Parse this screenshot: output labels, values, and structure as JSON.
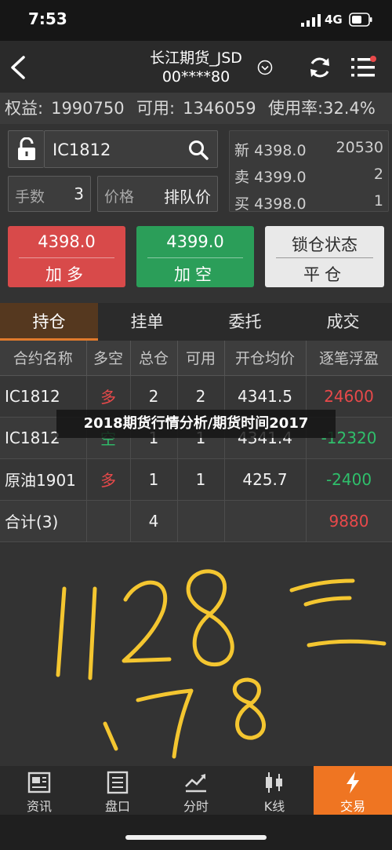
{
  "status": {
    "time": "7:53",
    "network": "4G"
  },
  "nav": {
    "title_line1": "长江期货_JSD",
    "title_line2": "00****80"
  },
  "account": {
    "equity_label": "权益:",
    "equity_value": "1990750",
    "available_label": "可用:",
    "available_value": "1346059",
    "usage_label": "使用率:",
    "usage_value": "32.4%"
  },
  "order": {
    "contract": "IC1812",
    "qty_label": "手数",
    "qty_value": "3",
    "price_label": "价格",
    "price_value": "排队价",
    "quotes": [
      {
        "label": "新",
        "price": "4398.0",
        "volume": "20530"
      },
      {
        "label": "卖",
        "price": "4399.0",
        "volume": "2"
      },
      {
        "label": "买",
        "price": "4398.0",
        "volume": "1"
      }
    ],
    "buttons": {
      "long_price": "4398.0",
      "long_label": "加多",
      "short_price": "4399.0",
      "short_label": "加空",
      "lock_label": "锁仓状态",
      "close_label": "平仓"
    }
  },
  "tabs": [
    "持仓",
    "挂单",
    "委托",
    "成交"
  ],
  "table": {
    "headers": [
      "合约名称",
      "多空",
      "总仓",
      "可用",
      "开仓均价",
      "逐笔浮盈"
    ],
    "rows": [
      {
        "name": "IC1812",
        "dir": "多",
        "total": "2",
        "avail": "2",
        "price": "4341.5",
        "pnl": "24600"
      },
      {
        "name": "IC1812",
        "dir": "空",
        "total": "1",
        "avail": "1",
        "price": "4341.4",
        "pnl": "-12320"
      },
      {
        "name": "原油1901",
        "dir": "多",
        "total": "1",
        "avail": "1",
        "price": "425.7",
        "pnl": "-2400"
      }
    ],
    "summary": {
      "name": "合计(3)",
      "total": "4",
      "pnl": "9880"
    }
  },
  "overlay_text": "2018期货行情分析/期货时间2017",
  "handwriting_text": "1128 三 178",
  "bottom_nav": [
    "资讯",
    "盘口",
    "分时",
    "K线",
    "交易"
  ],
  "colors": {
    "up": "#e8494a",
    "down": "#2fbf6b",
    "accent": "#ef7522",
    "ink": "#f4c630"
  }
}
